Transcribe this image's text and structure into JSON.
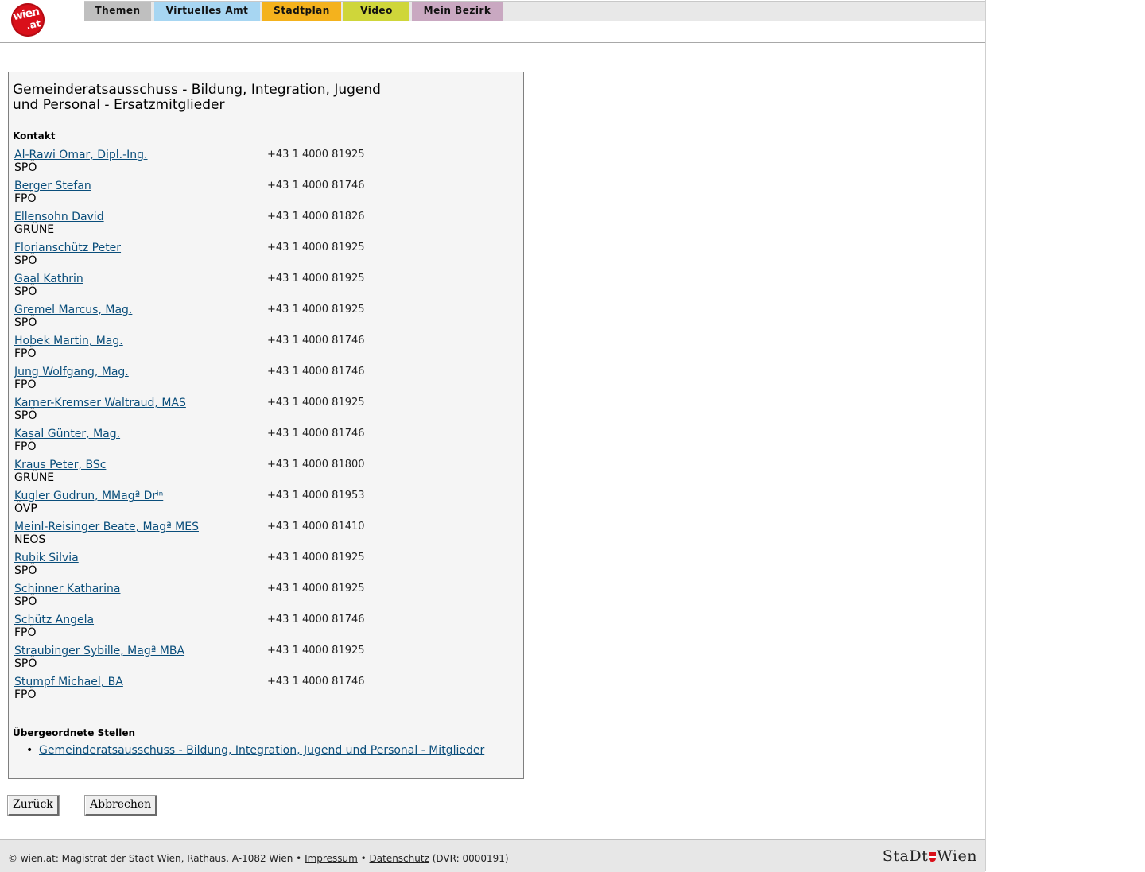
{
  "nav": {
    "logo_text_1": "wien",
    "logo_text_2": ".at",
    "tabs": [
      {
        "label": "Themen",
        "color": "#bfbfbf"
      },
      {
        "label": "Virtuelles Amt",
        "color": "#a7d6f2"
      },
      {
        "label": "Stadtplan",
        "color": "#f4b21d"
      },
      {
        "label": "Video",
        "color": "#cfd63a"
      },
      {
        "label": "Mein Bezirk",
        "color": "#c9a8c1"
      }
    ]
  },
  "box": {
    "title_line1": "Gemeinderatsausschuss - Bildung, Integration, Jugend",
    "title_line2": "und Personal - Ersatzmitglieder",
    "contact_heading": "Kontakt",
    "contacts": [
      {
        "name": "Al-Rawi Omar, Dipl.-Ing.",
        "party": "SPÖ",
        "phone": "+43 1 4000 81925"
      },
      {
        "name": "Berger Stefan",
        "party": "FPÖ",
        "phone": "+43 1 4000 81746"
      },
      {
        "name": "Ellensohn David",
        "party": "GRÜNE",
        "phone": "+43 1 4000 81826"
      },
      {
        "name": "Florianschütz Peter",
        "party": "SPÖ",
        "phone": "+43 1 4000 81925"
      },
      {
        "name": "Gaal Kathrin",
        "party": "SPÖ",
        "phone": "+43 1 4000 81925"
      },
      {
        "name": "Gremel Marcus, Mag.",
        "party": "SPÖ",
        "phone": "+43 1 4000 81925"
      },
      {
        "name": "Hobek Martin, Mag.",
        "party": "FPÖ",
        "phone": "+43 1 4000 81746"
      },
      {
        "name": "Jung Wolfgang, Mag.",
        "party": "FPÖ",
        "phone": "+43 1 4000 81746"
      },
      {
        "name": "Karner-Kremser Waltraud, MAS",
        "party": "SPÖ",
        "phone": "+43 1 4000 81925"
      },
      {
        "name": "Kasal Günter, Mag.",
        "party": "FPÖ",
        "phone": "+43 1 4000 81746"
      },
      {
        "name": "Kraus Peter, BSc",
        "party": "GRÜNE",
        "phone": "+43 1 4000 81800"
      },
      {
        "name": "Kugler Gudrun, MMagª Drⁱⁿ",
        "party": "ÖVP",
        "phone": "+43 1 4000 81953"
      },
      {
        "name": "Meinl-Reisinger Beate, Magª MES",
        "party": "NEOS",
        "phone": "+43 1 4000 81410"
      },
      {
        "name": "Rubik Silvia",
        "party": "SPÖ",
        "phone": "+43 1 4000 81925"
      },
      {
        "name": "Schinner Katharina",
        "party": "SPÖ",
        "phone": "+43 1 4000 81925"
      },
      {
        "name": "Schütz Angela",
        "party": "FPÖ",
        "phone": "+43 1 4000 81746"
      },
      {
        "name": "Straubinger Sybille, Magª MBA",
        "party": "SPÖ",
        "phone": "+43 1 4000 81925"
      },
      {
        "name": "Stumpf Michael, BA",
        "party": "FPÖ",
        "phone": "+43 1 4000 81746"
      }
    ],
    "parent_heading": "Übergeordnete Stellen",
    "parent_links": [
      {
        "label": "Gemeinderatsausschuss - Bildung, Integration, Jugend und Personal - Mitglieder"
      }
    ]
  },
  "buttons": {
    "back": "Zurück",
    "cancel": "Abbrechen"
  },
  "footer": {
    "prefix": "© wien.at: Magistrat der Stadt Wien, Rathaus, A-1082 Wien •",
    "impressum": "Impressum",
    "sep": "•",
    "datenschutz": "Datenschutz",
    "dvr": "(DVR: 0000191)",
    "logo_left": "StaDt",
    "logo_right": "Wien"
  }
}
